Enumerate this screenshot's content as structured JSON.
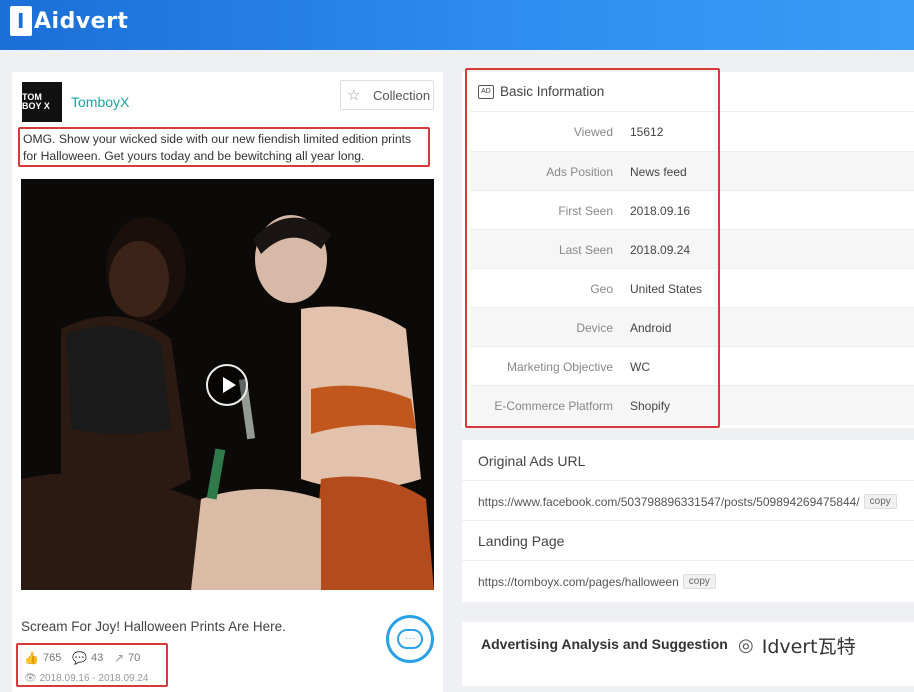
{
  "app": {
    "logo_mark": "I",
    "logo_text": "Aidvert"
  },
  "ad": {
    "brand_name": "TomboyX",
    "brand_logo_text": "TOM BOY X",
    "collection_label": "Collection",
    "text": "OMG. Show your wicked side with our new fiendish limited edition prints for Halloween. Get yours today and be bewitching all year long.",
    "headline": "Scream For Joy! Halloween Prints Are Here.",
    "likes": "765",
    "comments": "43",
    "shares": "70",
    "date_range": "2018.09.16 - 2018.09.24"
  },
  "basic_info": {
    "title": "Basic Information",
    "rows": [
      {
        "label": "Viewed",
        "value": "15612"
      },
      {
        "label": "Ads Position",
        "value": "News feed"
      },
      {
        "label": "First Seen",
        "value": "2018.09.16"
      },
      {
        "label": "Last Seen",
        "value": "2018.09.24"
      },
      {
        "label": "Geo",
        "value": "United States"
      },
      {
        "label": "Device",
        "value": "Android"
      },
      {
        "label": "Marketing Objective",
        "value": "WC"
      },
      {
        "label": "E-Commerce Platform",
        "value": "Shopify"
      }
    ]
  },
  "urls": {
    "original_title": "Original Ads URL",
    "original_url": "https://www.facebook.com/503798896331547/posts/509894269475844/",
    "landing_title": "Landing Page",
    "landing_url": "https://tomboyx.com/pages/halloween",
    "copy_label": "copy"
  },
  "analysis": {
    "title": "Advertising Analysis and Suggestion"
  },
  "watermark": {
    "text": "Idvert瓦特"
  },
  "colors": {
    "accent": "#2f8ff0",
    "highlight": "#d63a3a",
    "brand": "#1aa3a3"
  }
}
